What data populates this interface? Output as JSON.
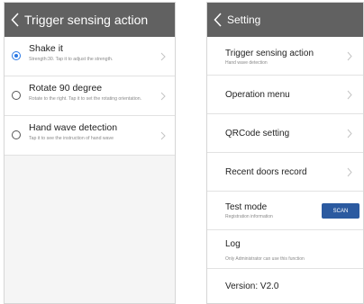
{
  "left": {
    "title": "Trigger sensing action",
    "options": [
      {
        "title": "Shake it",
        "desc": "Strength:30. Tap it to adjust the strength.",
        "selected": true
      },
      {
        "title": "Rotate 90 degree",
        "desc": "Rotate to the right. Tap it to set the rotating orientation.",
        "selected": false
      },
      {
        "title": "Hand wave detection",
        "desc": "Tap it to see the instruction of hand wave",
        "selected": false
      }
    ]
  },
  "right": {
    "title": "Setting",
    "rows": [
      {
        "label": "Trigger sensing action",
        "sub": "Hand wave detection"
      },
      {
        "label": "Operation menu"
      },
      {
        "label": "QRCode setting"
      },
      {
        "label": "Recent doors record"
      },
      {
        "label": "Test mode",
        "sub": "Registration information",
        "button": "SCAN"
      },
      {
        "label": "Log",
        "sub": "Only Administrator can use this function"
      },
      {
        "label": "Version: V2.0"
      }
    ]
  },
  "colors": {
    "titlebar": "#616161",
    "accent": "#2a78e4",
    "scan_button": "#2b5aa0"
  },
  "icons": [
    "back-arrow-icon",
    "chevron-right-icon",
    "radio-icon"
  ]
}
